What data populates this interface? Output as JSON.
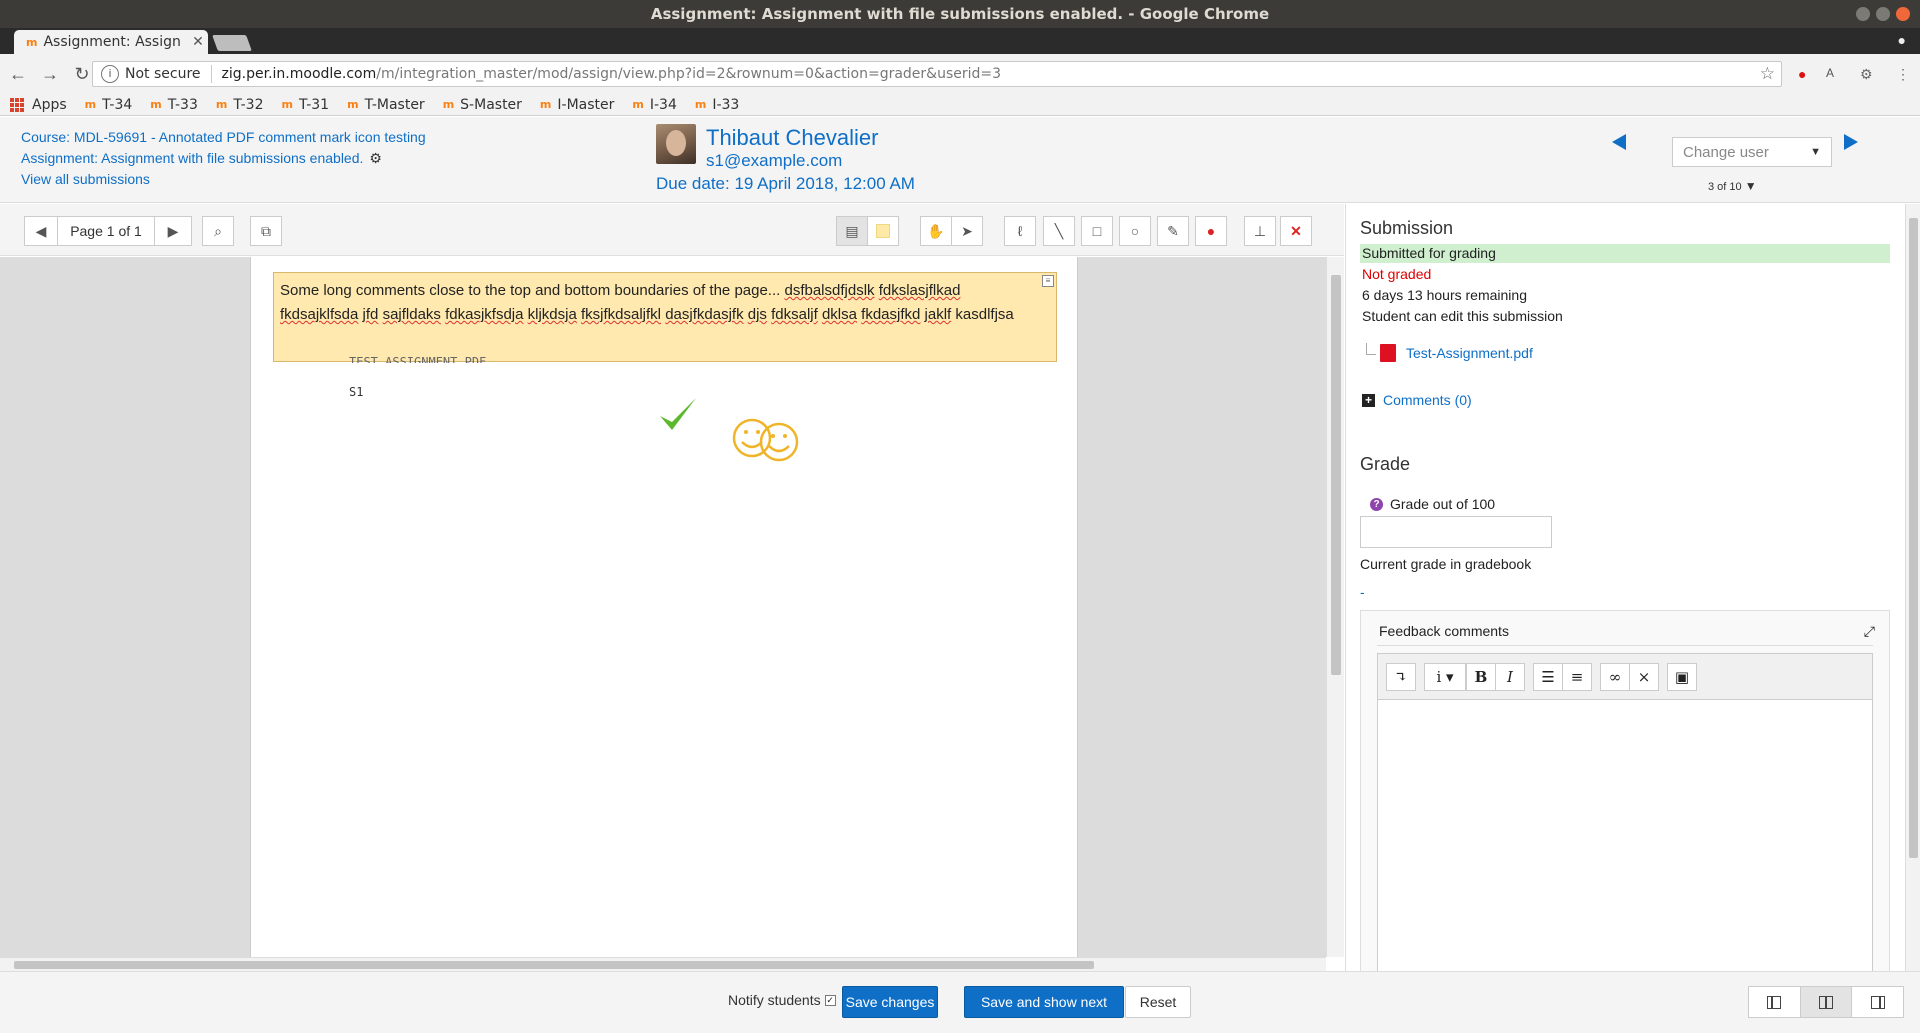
{
  "window": {
    "title": "Assignment: Assignment with file submissions enabled. - Google Chrome"
  },
  "tab": {
    "favicon": "m",
    "title": "Assignment: Assign",
    "close": "✕"
  },
  "omnibox": {
    "security": "Not secure",
    "host": "zig.per.in.moodle.com",
    "path": "/m/integration_master/mod/assign/view.php?id=2&rownum=0&action=grader&userid=3"
  },
  "bookmarks": {
    "apps": "Apps",
    "items": [
      "T-34",
      "T-33",
      "T-32",
      "T-31",
      "T-Master",
      "S-Master",
      "I-Master",
      "I-34",
      "I-33"
    ]
  },
  "header": {
    "course_link": "Course: MDL-59691 - Annotated PDF comment mark icon testing",
    "assignment_link": "Assignment: Assignment with file submissions enabled.",
    "view_all": "View all submissions",
    "user_name": "Thibaut Chevalier",
    "user_email": "s1@example.com",
    "due_date": "Due date: 19 April 2018, 12:00 AM",
    "change_user_placeholder": "Change user",
    "counter": "3 of 10"
  },
  "pdf_toolbar": {
    "page_label": "Page 1 of 1"
  },
  "pdf": {
    "comment_plain": "Some long comments close to the top and bottom boundaries of the page... ",
    "comment_words": [
      "dsfbalsdfjdslk",
      "fdkslasjflkad",
      "fkdsajklfsda",
      "jfd",
      "sajfldaks",
      "fdkasjkfsdja",
      "kljkdsja",
      "fksjfkdsaljfkl",
      "dasjfkdasjfk",
      "djs",
      "fdksaljf",
      "dklsa",
      "fkdasjfkd",
      "jaklf",
      "kasdlfjsa"
    ],
    "doc_line1": "TEST ASSIGNMENT PDF...",
    "doc_line2": "S1"
  },
  "submission": {
    "heading": "Submission",
    "status": "Submitted for grading",
    "grading_status": "Not graded",
    "time_remaining": "6 days 13 hours remaining",
    "edit_status": "Student can edit this submission",
    "file": "Test-Assignment.pdf",
    "comments": "Comments (0)"
  },
  "grade": {
    "heading": "Grade",
    "label": "Grade out of 100",
    "current_label": "Current grade in gradebook",
    "current_value": "-",
    "feedback_title": "Feedback comments"
  },
  "bottom": {
    "notify": "Notify students",
    "save": "Save changes",
    "save_next": "Save and show next",
    "reset": "Reset"
  },
  "colors": {
    "link": "#0f6fc6",
    "comment_bg": "#ffe9ae",
    "status_ok_bg": "#cfefcf",
    "not_graded": "#dd0000",
    "checkmark": "#5cb82c",
    "smiley": "#f0b429"
  }
}
